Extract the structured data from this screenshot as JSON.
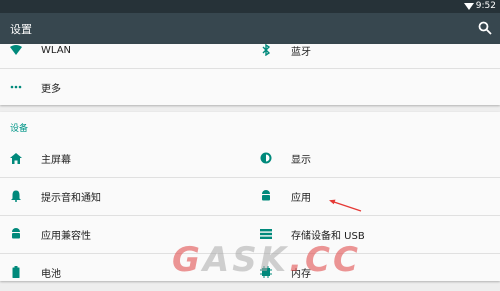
{
  "status": {
    "time": "9:52"
  },
  "appbar": {
    "title": "设置"
  },
  "wireless": {
    "items": [
      {
        "icon": "wifi-icon",
        "label": "WLAN"
      },
      {
        "icon": "bluetooth-icon",
        "label": "蓝牙"
      },
      {
        "icon": "more-icon",
        "label": "更多"
      }
    ]
  },
  "device": {
    "section_title": "设备",
    "items": [
      {
        "icon": "home-icon",
        "label": "主屏幕"
      },
      {
        "icon": "brightness-icon",
        "label": "显示"
      },
      {
        "icon": "bell-icon",
        "label": "提示音和通知"
      },
      {
        "icon": "android-icon",
        "label": "应用"
      },
      {
        "icon": "android-icon",
        "label": "应用兼容性"
      },
      {
        "icon": "storage-icon",
        "label": "存储设备和 USB"
      },
      {
        "icon": "battery-icon",
        "label": "电池"
      },
      {
        "icon": "memory-icon",
        "label": "内存"
      }
    ]
  },
  "watermark": {
    "text_a": "G",
    "text_b": "ASK",
    "text_c": ".CC"
  },
  "colors": {
    "statusbar": "#263238",
    "appbar": "#37474f",
    "accent": "#009688",
    "annotation": "#e53935"
  }
}
